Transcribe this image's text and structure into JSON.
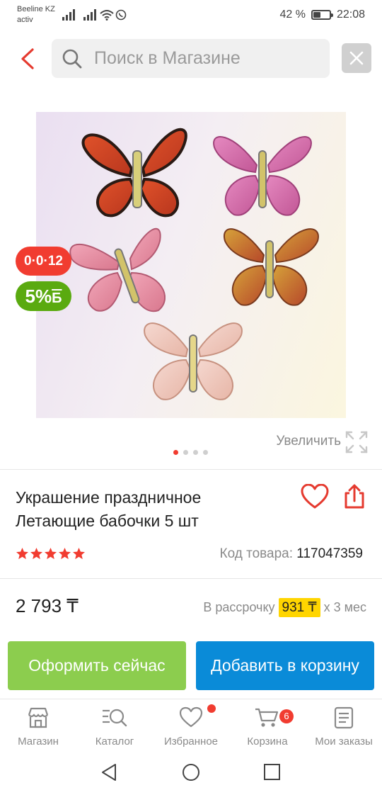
{
  "status_bar": {
    "carrier_line1": "Beeline KZ",
    "carrier_line2": "activ",
    "battery_text": "42 %",
    "battery_level": 0.42,
    "time": "22:08"
  },
  "search": {
    "placeholder": "Поиск в Магазине",
    "back_icon": "chevron-left-icon",
    "clear_icon": "close-icon"
  },
  "product": {
    "image_alt": "Украшение праздничное Летающие бабочки 5 шт",
    "badge_installment": "0·0·12",
    "badge_bonus": "5%",
    "badge_bonus_symbol": "Б",
    "zoom_label": "Увеличить",
    "carousel": {
      "count": 4,
      "active": 0
    },
    "title": "Украшение праздничное Летающие бабочки 5 шт",
    "rating": 5,
    "code_label": "Код товара:",
    "code_value": "117047359",
    "price": "2 793 ₸",
    "installment_prefix": "В рассрочку",
    "installment_amount": "931 ₸",
    "installment_suffix": "х 3 мес"
  },
  "actions": {
    "checkout": "Оформить сейчас",
    "add_to_cart": "Добавить в корзину"
  },
  "tabs": [
    {
      "label": "Магазин",
      "icon": "shop-icon"
    },
    {
      "label": "Каталог",
      "icon": "catalog-search-icon"
    },
    {
      "label": "Избранное",
      "icon": "heart-icon"
    },
    {
      "label": "Корзина",
      "icon": "cart-icon",
      "badge": "6"
    },
    {
      "label": "Мои заказы",
      "icon": "orders-icon"
    }
  ],
  "colors": {
    "accent_red": "#f13c30",
    "checkout_green": "#8ccd4e",
    "cart_blue": "#0a8bd8",
    "bonus_green": "#5aaa10",
    "installment_yellow": "#ffd500"
  }
}
